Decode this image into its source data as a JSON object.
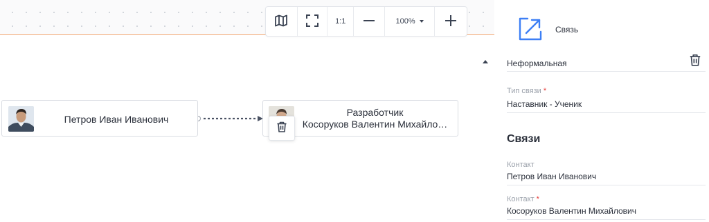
{
  "toolbar": {
    "map_icon": "map-icon",
    "fit_icon": "fullscreen-icon",
    "one_to_one_label": "1:1",
    "zoom_out_icon": "minus-icon",
    "zoom_value": "100%",
    "zoom_in_icon": "plus-icon"
  },
  "nodes": [
    {
      "name": "Петров Иван Иванович",
      "avatar": "person-photo"
    },
    {
      "role": "Разработчик",
      "name": "Косоруков Валентин Михайло…",
      "avatar": "person-photo"
    }
  ],
  "node_action": {
    "delete_icon": "trash-icon"
  },
  "panel": {
    "title": "Связь",
    "title_icon": "arrow-up-right-icon",
    "type_value": "Неформальная",
    "relation_type_label": "Тип связи",
    "relation_type_value": "Наставник - Ученик",
    "section_title": "Связи",
    "contact1_label": "Контакт",
    "contact1_value": "Петров Иван Иванович",
    "contact2_label": "Контакт",
    "contact2_value": "Косоруков Валентин Михайлович",
    "required_mark": "*"
  },
  "colors": {
    "accent": "#3d7ff5",
    "orange_line": "#f2a36b",
    "required": "#e53935"
  }
}
